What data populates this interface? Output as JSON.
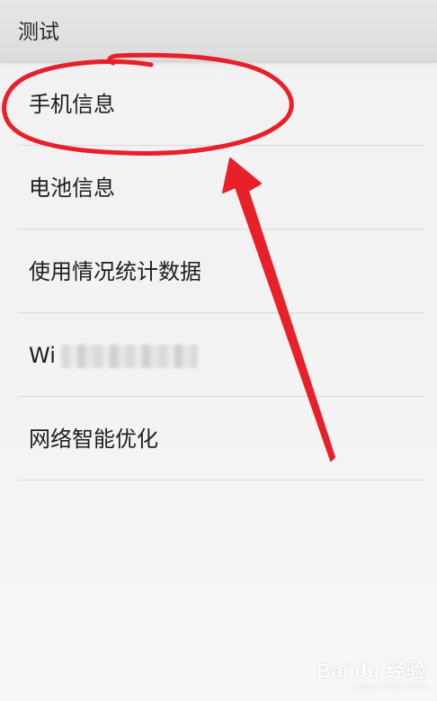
{
  "header": {
    "title": "测试"
  },
  "menu": {
    "items": [
      {
        "label": "手机信息"
      },
      {
        "label": "电池信息"
      },
      {
        "label": "使用情况统计数据"
      },
      {
        "label": "Wi"
      },
      {
        "label": "网络智能优化"
      }
    ]
  },
  "annotation": {
    "color": "#e8202a"
  },
  "watermark": {
    "brand": "Bai du 经验",
    "url": "jingyan.baidu.com"
  }
}
